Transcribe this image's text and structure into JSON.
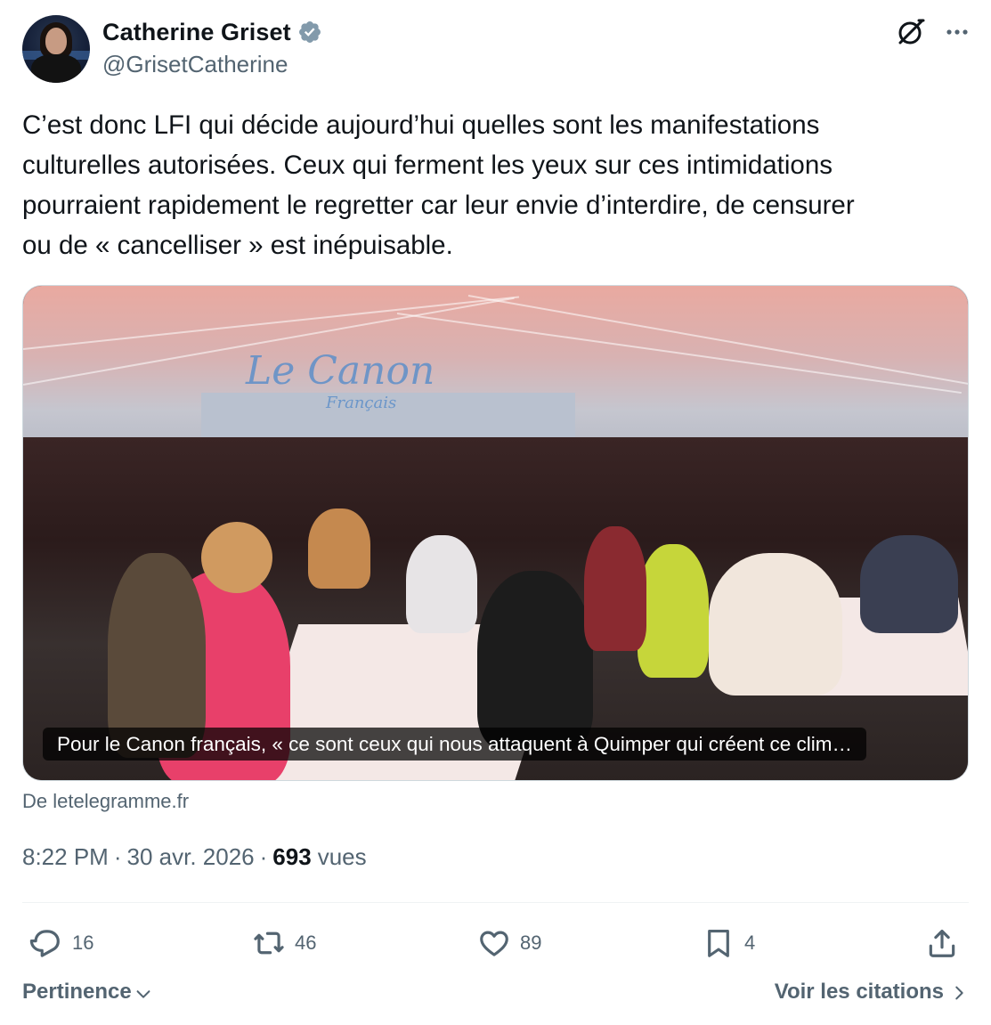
{
  "author": {
    "display_name": "Catherine Griset",
    "handle": "@GrisetCatherine",
    "verified_icon": "verified-badge-icon",
    "avatar": "avatar"
  },
  "header_actions": {
    "grok_icon": "grok-icon",
    "more_icon": "more-icon"
  },
  "tweet": {
    "text": "C’est donc LFI qui décide aujourd’hui quelles sont les manifestations\nculturelles autorisées. Ceux qui ferment les yeux sur ces intimidations\npourraient rapidement le regretter car leur envie d’interdire, de censurer\nou de « cancelliser » est inépuisable."
  },
  "media": {
    "caption": "Pour le Canon français, « ce sont ceux qui nous attaquent à Quimper qui créent ce clim…",
    "logo_text": "Le Canon",
    "logo_subtext": "Français",
    "source": "De letelegramme.fr"
  },
  "meta": {
    "time": "8:22 PM",
    "date": "30 avr. 2026",
    "separator": "·",
    "views_count": "693",
    "views_label": "vues"
  },
  "actions": {
    "replies": "16",
    "reposts": "46",
    "likes": "89",
    "bookmarks": "4"
  },
  "footer": {
    "sort_label": "Pertinence",
    "quotes_label": "Voir les citations"
  },
  "colors": {
    "text_primary": "#0f1419",
    "text_secondary": "#536471",
    "verified_blue": "#829aab",
    "divider": "#eff3f4"
  }
}
